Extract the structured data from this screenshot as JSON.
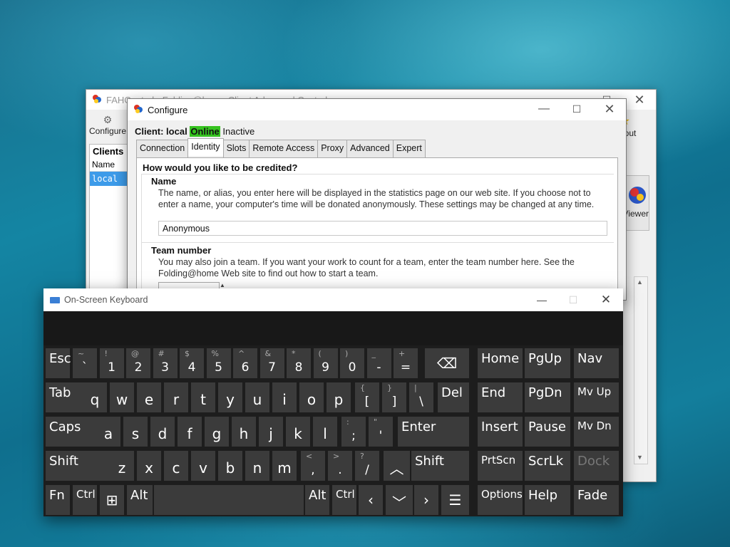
{
  "fah": {
    "title": "FAHControl - Folding@home Client Advanced Control",
    "toolbar": {
      "configure": "Configure",
      "about": "About",
      "viewer": "Viewer"
    },
    "clients": {
      "header": "Clients",
      "column": "Name",
      "row": "local"
    }
  },
  "configure": {
    "title": "Configure",
    "client_label": "Client: local",
    "online": "Online",
    "inactive": "Inactive",
    "tabs": [
      "Connection",
      "Identity",
      "Slots",
      "Remote Access",
      "Proxy",
      "Advanced",
      "Expert"
    ],
    "active_tab": "Identity",
    "question": "How would you like to be credited?",
    "name_section": "Name",
    "name_desc": "The name, or alias, you enter here will be displayed in the statistics page on our web site.  If you choose not to enter a name, your computer's time will be donated anonymously.  These settings may be changed at any time.",
    "name_value": "Anonymous",
    "team_section": "Team number",
    "team_desc": "You may also join a team.  If you want your work to count for a team, enter the team number here.  See the Folding@home Web site to find out how to start a team."
  },
  "osk": {
    "title": "On-Screen Keyboard",
    "row1": [
      {
        "main": "Esc"
      },
      {
        "shift": "~",
        "low": "`"
      },
      {
        "shift": "!",
        "low": "1"
      },
      {
        "shift": "@",
        "low": "2"
      },
      {
        "shift": "#",
        "low": "3"
      },
      {
        "shift": "$",
        "low": "4"
      },
      {
        "shift": "%",
        "low": "5"
      },
      {
        "shift": "^",
        "low": "6"
      },
      {
        "shift": "&",
        "low": "7"
      },
      {
        "shift": "*",
        "low": "8"
      },
      {
        "shift": "(",
        "low": "9"
      },
      {
        "shift": ")",
        "low": "0"
      },
      {
        "shift": "_",
        "low": "-"
      },
      {
        "shift": "+",
        "low": "="
      }
    ],
    "row2_letters": [
      "q",
      "w",
      "e",
      "r",
      "t",
      "y",
      "u",
      "i",
      "o",
      "p"
    ],
    "row3_letters": [
      "a",
      "s",
      "d",
      "f",
      "g",
      "h",
      "j",
      "k",
      "l"
    ],
    "row4_letters": [
      "z",
      "x",
      "c",
      "v",
      "b",
      "n",
      "m"
    ],
    "keys": {
      "tab": "Tab",
      "del": "Del",
      "caps": "Caps",
      "enter": "Enter",
      "shift": "Shift",
      "fn": "Fn",
      "ctrl": "Ctrl",
      "alt": "Alt",
      "home": "Home",
      "pgup": "PgUp",
      "nav": "Nav",
      "end": "End",
      "pgdn": "PgDn",
      "mvup": "Mv Up",
      "insert": "Insert",
      "pause": "Pause",
      "mvdn": "Mv Dn",
      "prtscn": "PrtScn",
      "scrlk": "ScrLk",
      "dock": "Dock",
      "options": "Options",
      "help": "Help",
      "fade": "Fade"
    },
    "punct": {
      "lbrace_s": "{",
      "lbrace_l": "[",
      "rbrace_s": "}",
      "rbrace_l": "]",
      "pipe_s": "|",
      "pipe_l": "\\",
      "colon_s": ":",
      "colon_l": ";",
      "quote_s": "\"",
      "quote_l": "'",
      "lt_s": "<",
      "lt_l": ",",
      "gt_s": ">",
      "gt_l": ".",
      "q_s": "?",
      "q_l": "/"
    }
  }
}
